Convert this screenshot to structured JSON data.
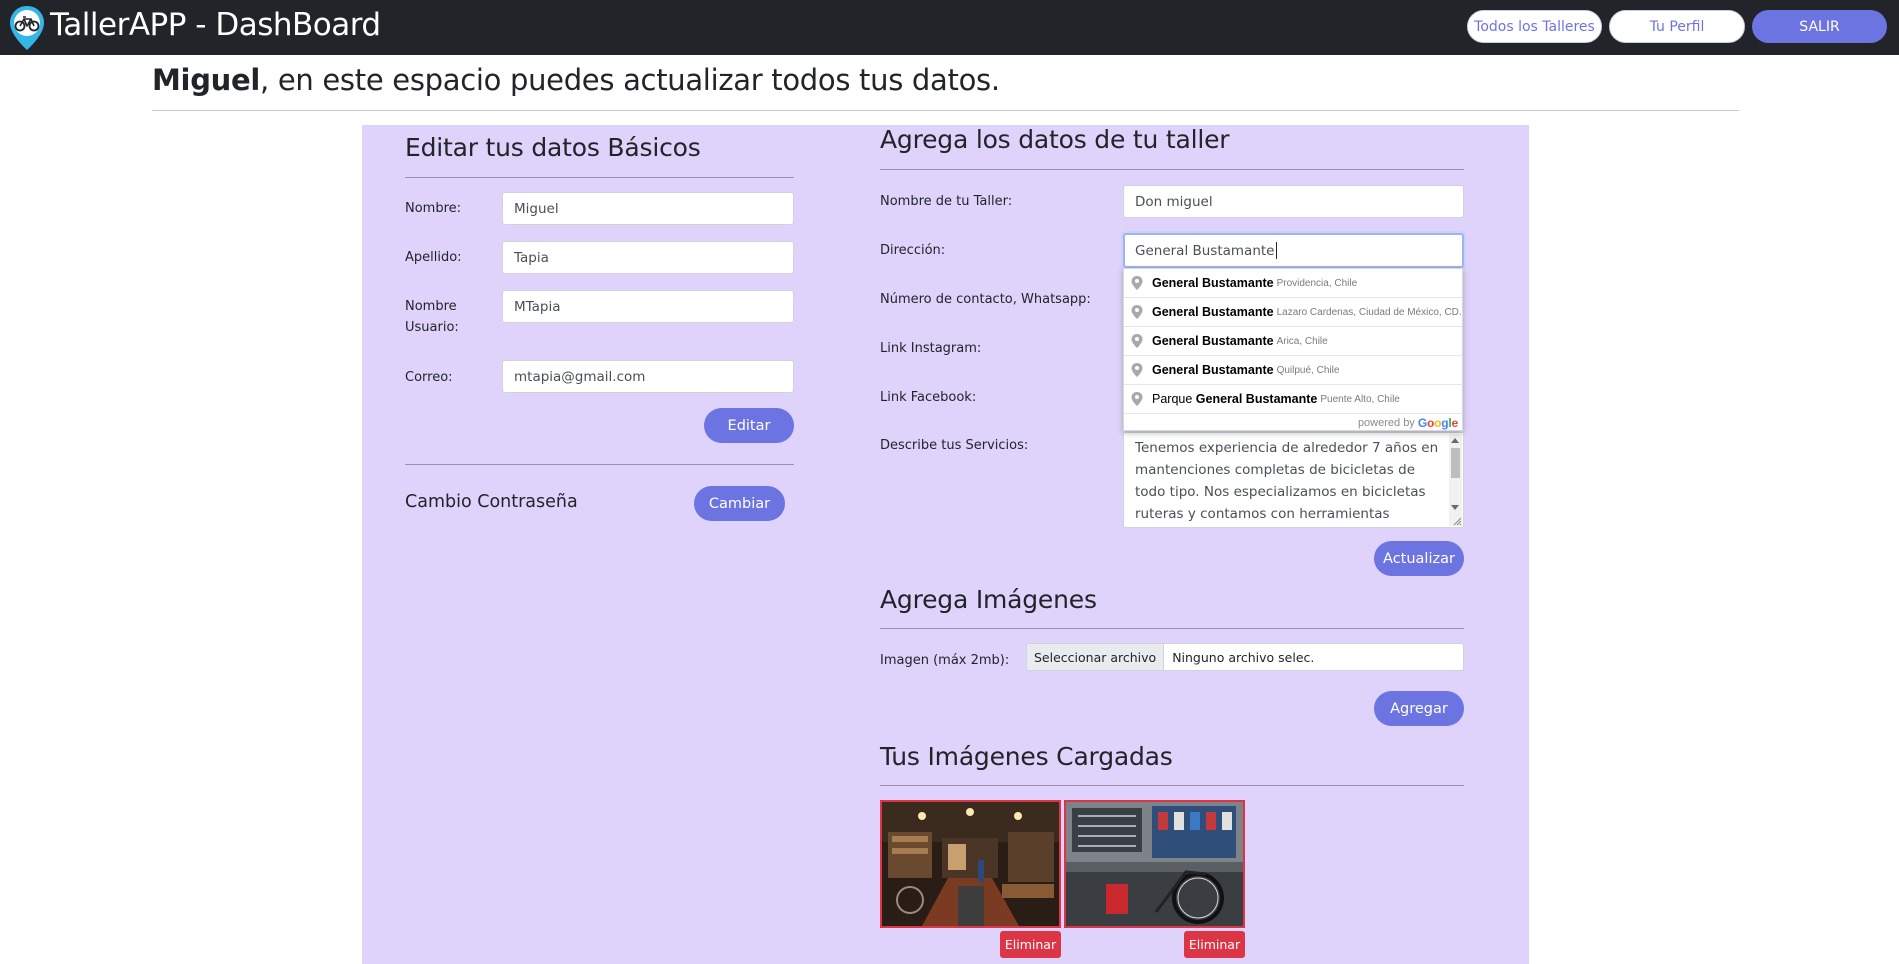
{
  "navbar": {
    "brand_title": "TallerAPP - DashBoard",
    "brand_icon": "bicycle-map-pin-icon",
    "buttons": {
      "all_workshops": "Todos los Talleres",
      "profile": "Tu Perfil",
      "logout": "SALIR"
    }
  },
  "greeting": {
    "name": "Miguel",
    "text": ", en este espacio puedes actualizar todos tus datos."
  },
  "basic": {
    "title": "Editar tus datos Básicos",
    "fields": {
      "first_name": {
        "label": "Nombre:",
        "value": "Miguel"
      },
      "last_name": {
        "label": "Apellido:",
        "value": "Tapia"
      },
      "username": {
        "label": "Nombre Usuario:",
        "value": "MTapia"
      },
      "email": {
        "label": "Correo:",
        "value": "mtapia@gmail.com"
      }
    },
    "edit_button": "Editar",
    "password_label": "Cambio Contraseña",
    "change_button": "Cambiar"
  },
  "workshop": {
    "title": "Agrega los datos de tu taller",
    "name": {
      "label": "Nombre de tu Taller:",
      "value": "Don miguel"
    },
    "address": {
      "label": "Dirección:",
      "value": "General Bustamante"
    },
    "phone": {
      "label": "Número de contacto, Whatsapp:"
    },
    "instagram": {
      "label": "Link Instagram:"
    },
    "facebook": {
      "label": "Link Facebook:"
    },
    "services": {
      "label": "Describe tus Servicios:",
      "value": "Tenemos experiencia de alrededor 7 años en mantenciones completas de bicicletas de todo tipo. Nos especializamos en bicicletas ruteras y contamos con herramientas especificas para"
    },
    "update_button": "Actualizar",
    "autocomplete": {
      "suggestions": [
        {
          "prefix": "",
          "match": "General Bustamante",
          "secondary": "Providencia, Chile"
        },
        {
          "prefix": "",
          "match": "General Bustamante",
          "secondary": "Lazaro Cardenas, Ciudad de México, CD..."
        },
        {
          "prefix": "",
          "match": "General Bustamante",
          "secondary": "Arica, Chile"
        },
        {
          "prefix": "",
          "match": "General Bustamante",
          "secondary": "Quilpué, Chile"
        },
        {
          "prefix": "Parque ",
          "match": "General Bustamante",
          "secondary": "Puente Alto, Chile"
        }
      ],
      "powered_by": "powered by",
      "google": "Google"
    }
  },
  "images": {
    "title": "Agrega Imágenes",
    "label": "Imagen (máx 2mb):",
    "file_button": "Seleccionar archivo",
    "file_status": "Ninguno archivo selec.",
    "add_button": "Agregar"
  },
  "uploaded": {
    "title": "Tus Imágenes Cargadas",
    "items": [
      {
        "delete_label": "Eliminar"
      },
      {
        "delete_label": "Eliminar"
      }
    ]
  },
  "colors": {
    "navbar": "#212429",
    "accent": "#6c74e2",
    "panel": "#dfd3fb",
    "danger": "#dc3545"
  }
}
